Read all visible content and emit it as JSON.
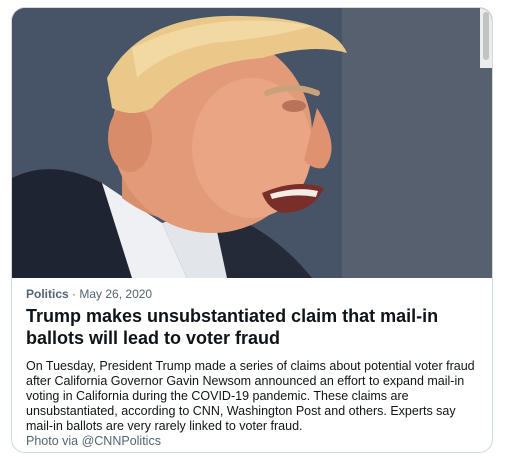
{
  "card": {
    "category": "Politics",
    "separator": "·",
    "date": "May 26, 2020",
    "headline": "Trump makes unsubstantiated claim that mail-in ballots will lead to voter fraud",
    "description": "On Tuesday, President Trump made a series of claims about potential voter fraud after California Governor Gavin Newsom announced an effort to expand mail-in voting in California during the COVID-19 pandemic. These claims are unsubstantiated, according to CNN, Washington Post and others. Experts say mail-in ballots are very rarely linked to voter fraud.",
    "credit": "Photo via @CNNPolitics"
  },
  "colors": {
    "border": "#cfd9de",
    "text": "#0f1419",
    "secondary": "#536471"
  }
}
